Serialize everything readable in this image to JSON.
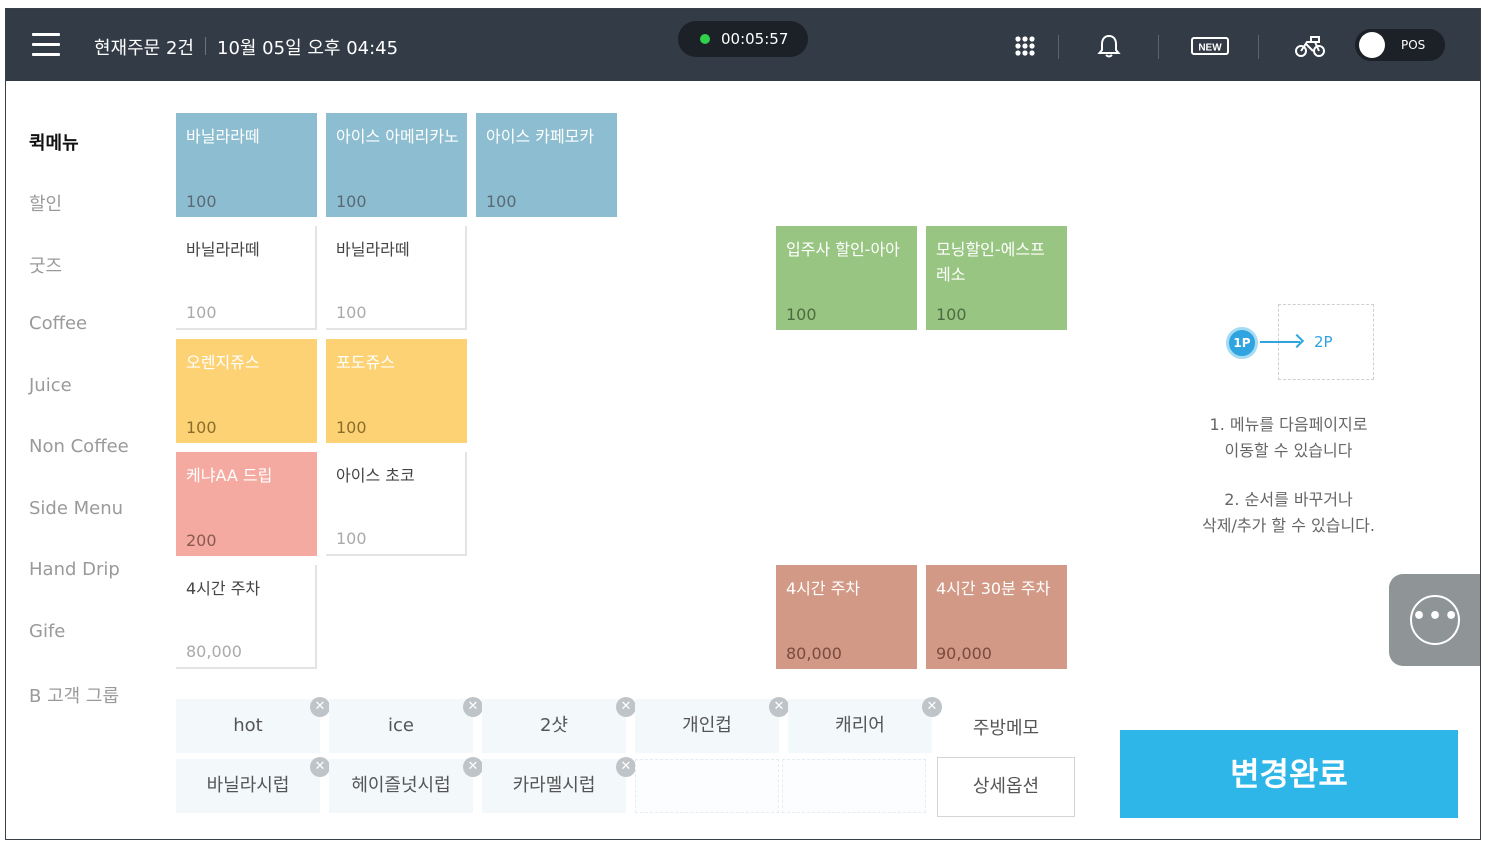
{
  "header": {
    "order_count": "현재주문 2건",
    "datetime": "10월 05일 오후 04:45",
    "timer": "00:05:57",
    "new_badge": "NEW",
    "pos_label": "POS",
    "icons": [
      "menu-icon",
      "grid-icon",
      "bell-icon",
      "new-icon",
      "delivery-bike-icon"
    ]
  },
  "sidebar": {
    "items": [
      "퀵메뉴",
      "할인",
      "굿즈",
      "Coffee",
      "Juice",
      "Non Coffee",
      "Side Menu",
      "Hand Drip",
      "Gife",
      "B 고객 그룹"
    ],
    "active": "퀵메뉴"
  },
  "tiles": [
    {
      "name": "바닐라라떼",
      "price": "100",
      "color": "blue"
    },
    {
      "name": "아이스 아메리카노",
      "price": "100",
      "color": "blue"
    },
    {
      "name": "아이스 카페모카",
      "price": "100",
      "color": "blue"
    },
    {
      "name": "바닐라라떼",
      "price": "100",
      "color": "white"
    },
    {
      "name": "바닐라라떼",
      "price": "100",
      "color": "white"
    },
    {
      "name": "입주사 할인-아아",
      "price": "100",
      "color": "green"
    },
    {
      "name": "모닝할인-에스프레소",
      "price": "100",
      "color": "green"
    },
    {
      "name": "오렌지쥬스",
      "price": "100",
      "color": "yellow"
    },
    {
      "name": "포도쥬스",
      "price": "100",
      "color": "yellow"
    },
    {
      "name": "케냐AA 드립",
      "price": "200",
      "color": "pink"
    },
    {
      "name": "아이스 초코",
      "price": "100",
      "color": "white"
    },
    {
      "name": "4시간 주차",
      "price": "80,000",
      "color": "white"
    },
    {
      "name": "4시간 주차",
      "price": "80,000",
      "color": "brown"
    },
    {
      "name": "4시간 30분 주차",
      "price": "90,000",
      "color": "brown"
    }
  ],
  "options": {
    "row1": [
      "hot",
      "ice",
      "2샷",
      "개인컵",
      "캐리어"
    ],
    "row2": [
      "바닐라시럽",
      "헤이즐넛시럽",
      "카라멜시럽"
    ],
    "kitchen_memo": "주방메모",
    "detail_button": "상세옵션",
    "remove_symbol": "✕"
  },
  "hint": {
    "page1": "1P",
    "page2": "2P",
    "line1a": "1. 메뉴를 다음페이지로",
    "line1b": "이동할 수 있습니다",
    "line2a": "2. 순서를 바꾸거나",
    "line2b": "삭제/추가 할 수 있습니다."
  },
  "done_button": "변경완료",
  "chat_symbol": "•••",
  "colors": {
    "header_bg": "#323b46",
    "accent": "#2fb6e8",
    "tile_blue": "#8dbdd0",
    "tile_yellow": "#fdd274",
    "tile_pink": "#f5aaa1",
    "tile_green": "#98c682",
    "tile_brown": "#d29a86",
    "timer_dot": "#2fd04a"
  }
}
